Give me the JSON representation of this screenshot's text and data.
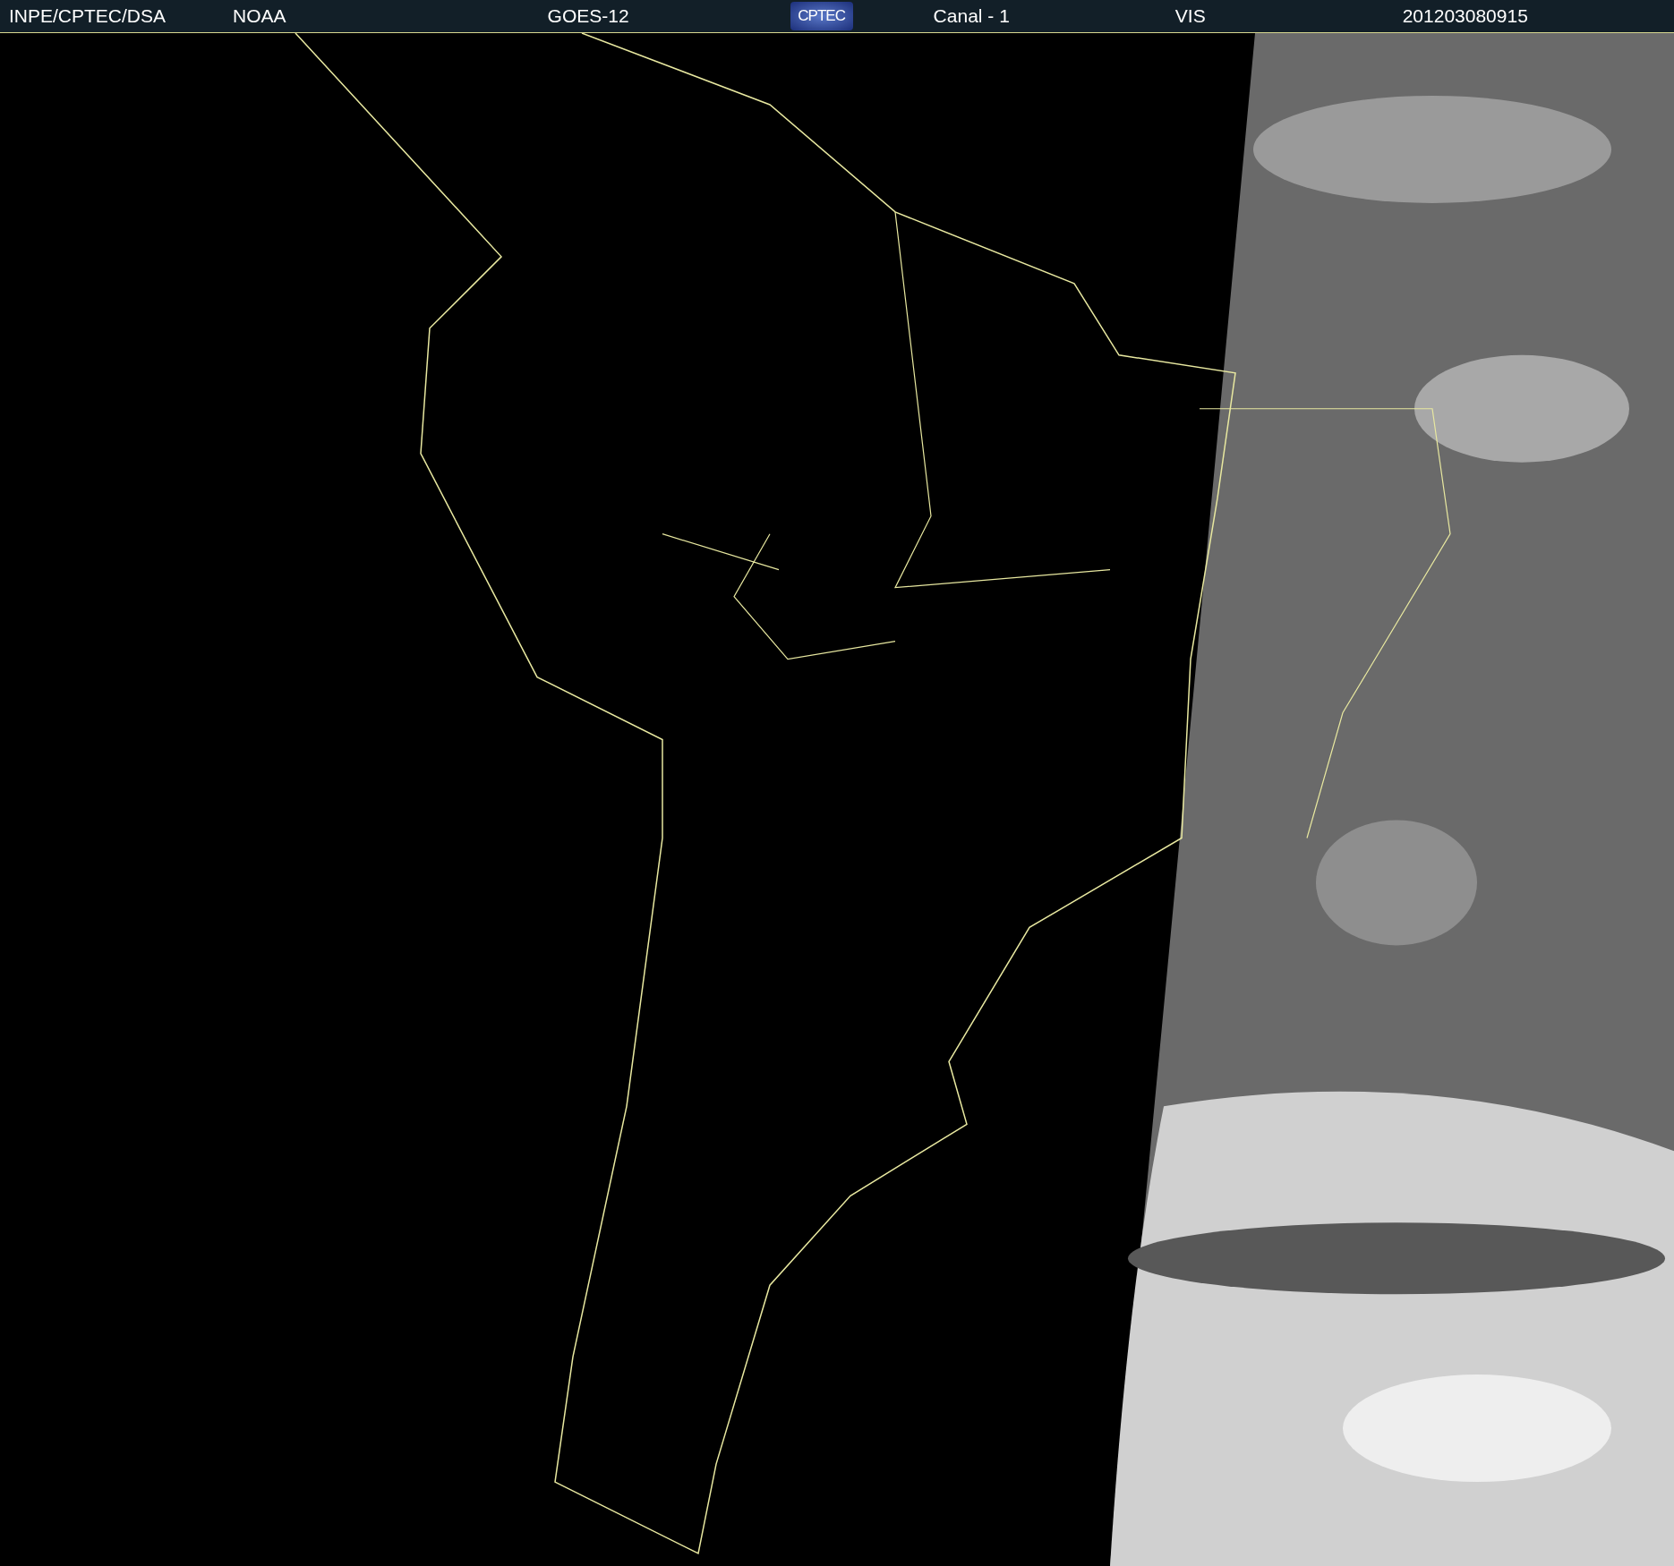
{
  "header": {
    "items": [
      {
        "kind": "text",
        "text": "INPE/CPTEC/DSA"
      },
      {
        "kind": "text",
        "text": "NOAA"
      },
      {
        "kind": "text",
        "text": "GOES-12"
      },
      {
        "kind": "logo",
        "text": "CPTEC"
      },
      {
        "kind": "text",
        "text": "Canal - 1"
      },
      {
        "kind": "text",
        "text": "VIS"
      },
      {
        "kind": "text",
        "text": "201203080915"
      }
    ]
  }
}
